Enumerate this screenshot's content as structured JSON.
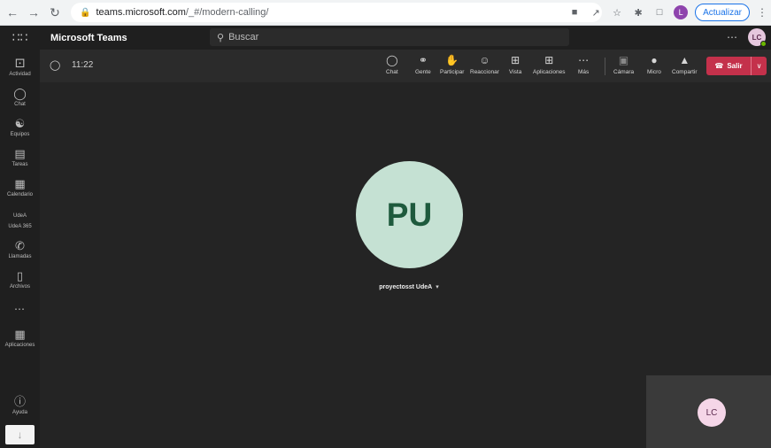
{
  "browser": {
    "url_host": "teams.microsoft.com",
    "url_path": "/_#/modern-calling/",
    "profile_initial": "L",
    "update_label": "Actualizar"
  },
  "header": {
    "app_name": "Microsoft Teams",
    "search_placeholder": "Buscar",
    "user_initials": "LC"
  },
  "rail": {
    "items": [
      {
        "label": "Actividad"
      },
      {
        "label": "Chat"
      },
      {
        "label": "Equipos"
      },
      {
        "label": "Tareas"
      },
      {
        "label": "Calendario"
      },
      {
        "label": "UdeA 365",
        "icon_text": "UdeA"
      },
      {
        "label": "Llamadas"
      },
      {
        "label": "Archivos"
      },
      {
        "label": "Aplicaciones"
      },
      {
        "label": "Ayuda"
      }
    ]
  },
  "meeting": {
    "timer": "11:22",
    "toolbar": [
      {
        "label": "Chat"
      },
      {
        "label": "Gente"
      },
      {
        "label": "Participar"
      },
      {
        "label": "Reaccionar"
      },
      {
        "label": "Vista"
      },
      {
        "label": "Aplicaciones"
      },
      {
        "label": "Más"
      },
      {
        "label": "Cámara"
      },
      {
        "label": "Micro"
      },
      {
        "label": "Compartir"
      }
    ],
    "leave_label": "Salir",
    "participant_initials": "PU",
    "participant_name": "proyectosst UdeA",
    "self_initials": "LC"
  },
  "colors": {
    "leave": "#c4314b",
    "participant_avatar": "#c5e1d3",
    "self_avatar": "#f5d6e8",
    "app_bg": "#1f1f1f"
  }
}
